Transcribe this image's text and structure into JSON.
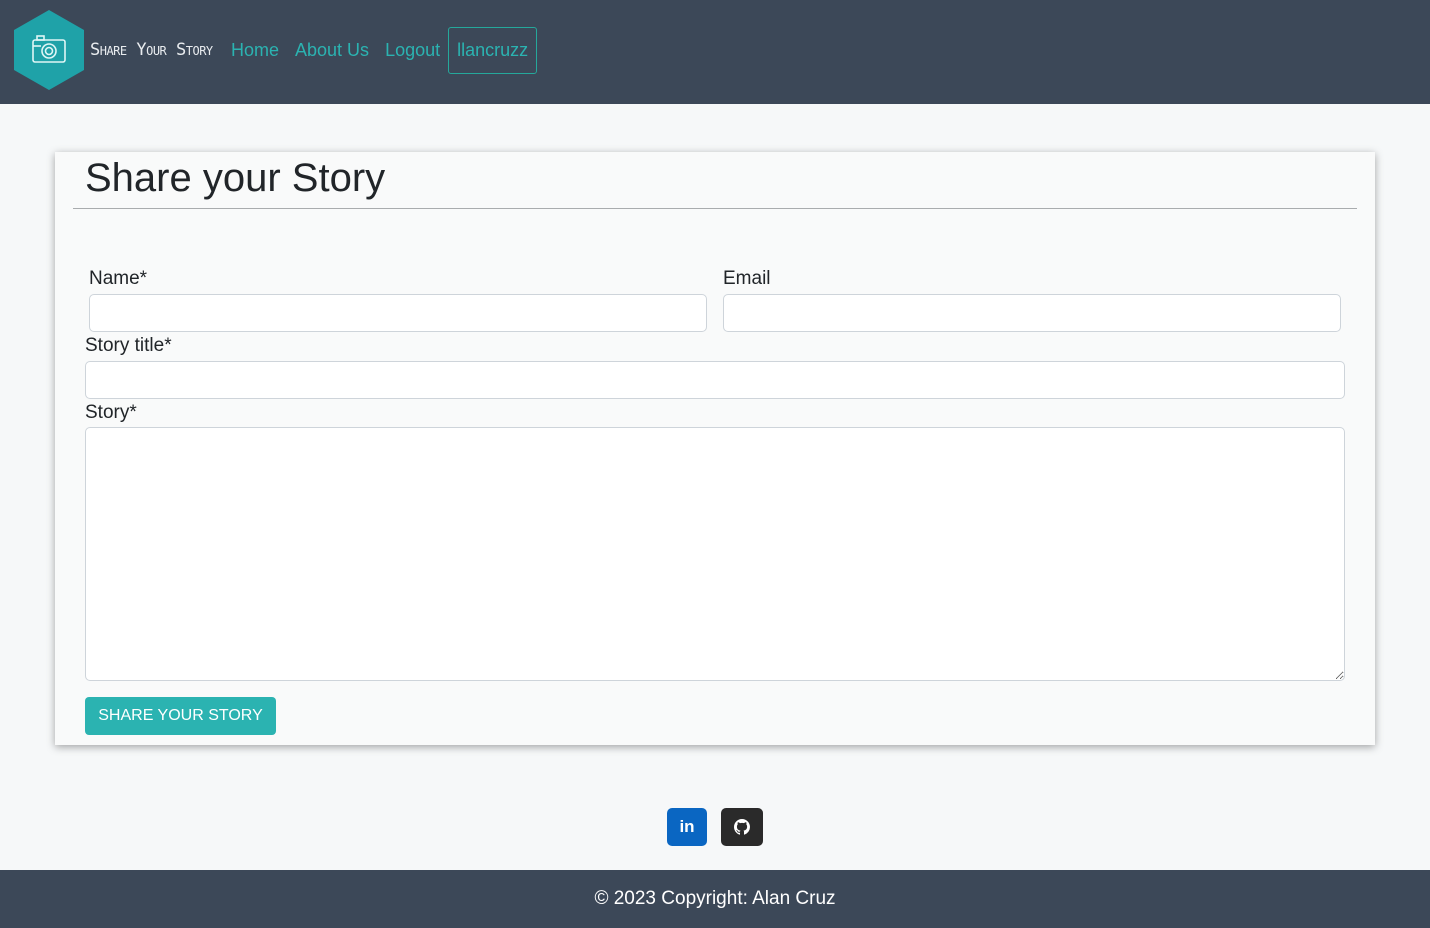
{
  "header": {
    "brand_text": "Share Your Story",
    "logo_icon": "camera-icon",
    "nav": {
      "home": "Home",
      "about": "About Us",
      "logout": "Logout",
      "user": "llancruzz"
    }
  },
  "colors": {
    "header_bg": "#3c4858",
    "accent": "#2bb3b1",
    "linkedin": "#0a66c2",
    "github": "#2a2a2a"
  },
  "form": {
    "title": "Share your Story",
    "name_label": "Name*",
    "name_value": "",
    "email_label": "Email",
    "email_value": "",
    "story_title_label": "Story title*",
    "story_title_value": "",
    "story_label": "Story*",
    "story_value": "",
    "submit_label": "Share your story"
  },
  "social": {
    "linkedin_glyph": "in",
    "linkedin_icon": "linkedin-icon",
    "github_icon": "github-icon"
  },
  "footer": {
    "copyright": "© 2023 Copyright: Alan Cruz"
  }
}
